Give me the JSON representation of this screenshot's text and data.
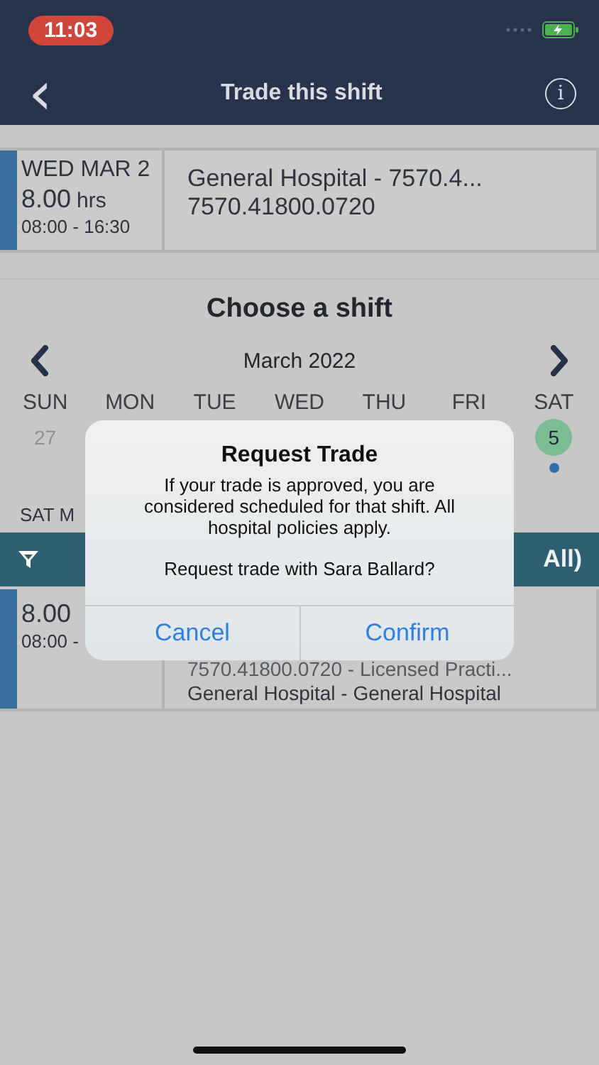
{
  "status_bar": {
    "time": "11:03"
  },
  "nav": {
    "back": "‹",
    "title": "Trade this shift",
    "info": "i"
  },
  "current_shift": {
    "date": "WED MAR 2",
    "hours": "8.00",
    "unit": "hrs",
    "time": "08:00 - 16:30",
    "location": "General Hospital - 7570.4...",
    "code": "7570.41800.0720"
  },
  "picker": {
    "title": "Choose a shift",
    "month": "March 2022",
    "days": [
      {
        "label": "SUN",
        "date": "27",
        "selected": false,
        "has_shift": false
      },
      {
        "label": "MON"
      },
      {
        "label": "TUE"
      },
      {
        "label": "WED"
      },
      {
        "label": "THU"
      },
      {
        "label": "FRI"
      },
      {
        "label": "SAT",
        "date": "5",
        "selected": true,
        "has_shift": true
      }
    ]
  },
  "list": {
    "heading": "SAT M",
    "filter_label": "All)",
    "rows": [
      {
        "hours": "8.00",
        "time": "08:00 -",
        "lines": [
          "7570.41800.0720 - Licensed Practi...",
          "General Hospital - General Hospital"
        ]
      }
    ]
  },
  "dialog": {
    "title": "Request Trade",
    "message": "If your trade is approved, you are considered scheduled for that shift. All hospital policies apply.",
    "question": "Request trade with Sara Ballard?",
    "buttons": [
      "Cancel",
      "Confirm"
    ]
  }
}
